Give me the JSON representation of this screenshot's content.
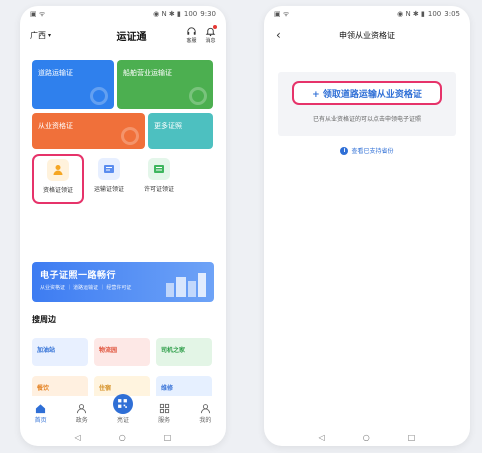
{
  "left": {
    "status": {
      "left_icons": "▣ ᯤ",
      "right_icons": "◉ N ✱ ▮",
      "battery": "100",
      "time": "9:30"
    },
    "header": {
      "region": "广西",
      "title": "运证通",
      "service": "客服",
      "messages": "消息"
    },
    "cards": {
      "road": "道路运输证",
      "ship": "船舶营业运输证",
      "qualification": "从业资格证",
      "more": "更多证照"
    },
    "quick": [
      {
        "label": "资格证领证"
      },
      {
        "label": "运输证领证"
      },
      {
        "label": "许可证领证"
      }
    ],
    "banner": {
      "title": "电子证照一路畅行",
      "subtitle": "从业资格证 ｜ 道路运输证 ｜ 经营许可证"
    },
    "section_title": "搜周边",
    "nearby": {
      "gas": "加油站",
      "logistics": "物流园",
      "driver": "司机之家",
      "food": "餐饮",
      "hotel": "住宿",
      "repair": "维修"
    },
    "nav": {
      "home": "首页",
      "gov": "政务",
      "license": "亮证",
      "service": "服务",
      "mine": "我的"
    },
    "sys_nav": {
      "back": "◁",
      "home": "○",
      "recent": "□"
    }
  },
  "right": {
    "status": {
      "left_icons": "▣ ᯤ",
      "right_icons": "◉ N ✱ ▮",
      "battery": "100",
      "time": "3:05"
    },
    "back": "‹",
    "title": "申领从业资格证",
    "apply_button": "+ 领取道路运输从业资格证",
    "apply_hint": "已有从业资格证的可以点击申领电子证照",
    "support_link": "查看已支持省份",
    "info_icon": "i",
    "sys_nav": {
      "back": "◁",
      "home": "○",
      "recent": "□"
    }
  },
  "colors": {
    "primary": "#2f6fd6",
    "highlight": "#e6336a",
    "road_card": "#2f80ed",
    "ship_card": "#4caf50",
    "qual_card": "#f0703a",
    "more_card": "#4dc0c0"
  }
}
